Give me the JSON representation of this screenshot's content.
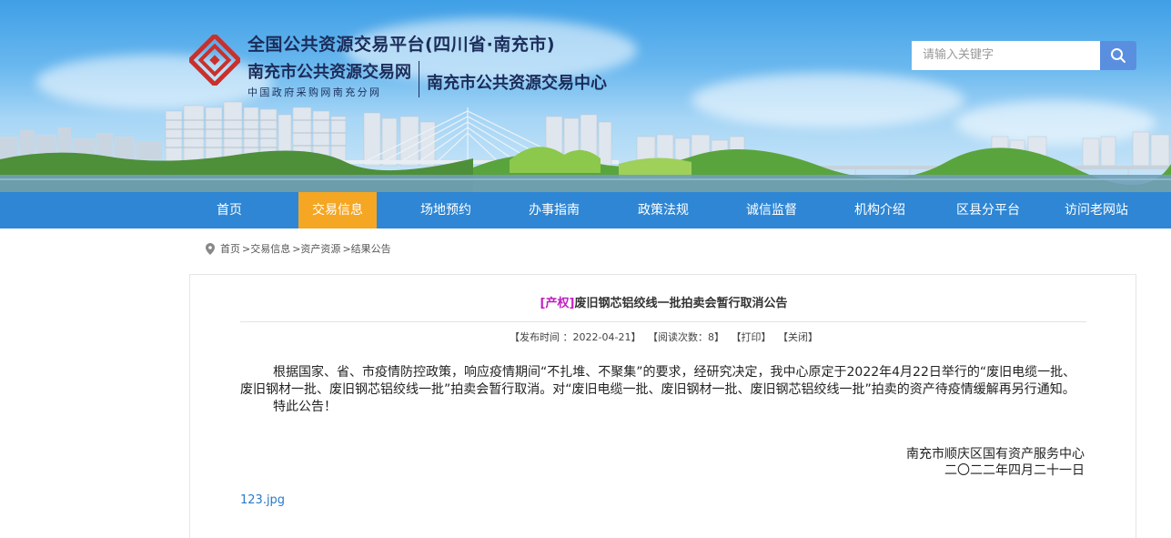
{
  "header": {
    "logo_line1": "全国公共资源交易平台(四川省·南充市)",
    "logo_line2": "南充市公共资源交易网",
    "logo_line3": "中国政府采购网南充分网",
    "center_name": "南充市公共资源交易中心",
    "search_placeholder": "请输入关键字",
    "search_icon": "search-icon"
  },
  "nav": {
    "items": [
      {
        "label": "首页"
      },
      {
        "label": "交易信息",
        "active": true
      },
      {
        "label": "场地预约"
      },
      {
        "label": "办事指南"
      },
      {
        "label": "政策法规"
      },
      {
        "label": "诚信监督"
      },
      {
        "label": "机构介绍"
      },
      {
        "label": "区县分平台"
      },
      {
        "label": "访问老网站"
      }
    ],
    "bg_color": "#2e86d4",
    "active_color": "#f5a623"
  },
  "breadcrumb": {
    "icon": "location-pin-icon",
    "items": [
      "首页",
      ">交易信息",
      ">资产资源",
      ">结果公告"
    ]
  },
  "article": {
    "tag": "[产权]",
    "title": "废旧钢芯铝绞线一批拍卖会暂行取消公告",
    "meta": {
      "date": "【发布时间 ：2022-04-21】",
      "views": "【阅读次数：8】",
      "print": "【打印】",
      "close": "【关闭】"
    },
    "paragraphs": [
      "根据国家、省、市疫情防控政策，响应疫情期间“不扎堆、不聚集”的要求，经研究决定，我中心原定于2022年4月22日举行的“废旧电缆一批、废旧钢材一批、废旧钢芯铝绞线一批”拍卖会暂行取消。对“废旧电缆一批、废旧钢材一批、废旧钢芯铝绞线一批”拍卖的资产待疫情缓解再另行通知。",
      "特此公告！"
    ],
    "signature": {
      "org": "南充市顺庆区国有资产服务中心",
      "date": "二〇二二年四月二十一日"
    },
    "attachment": "123.jpg"
  }
}
